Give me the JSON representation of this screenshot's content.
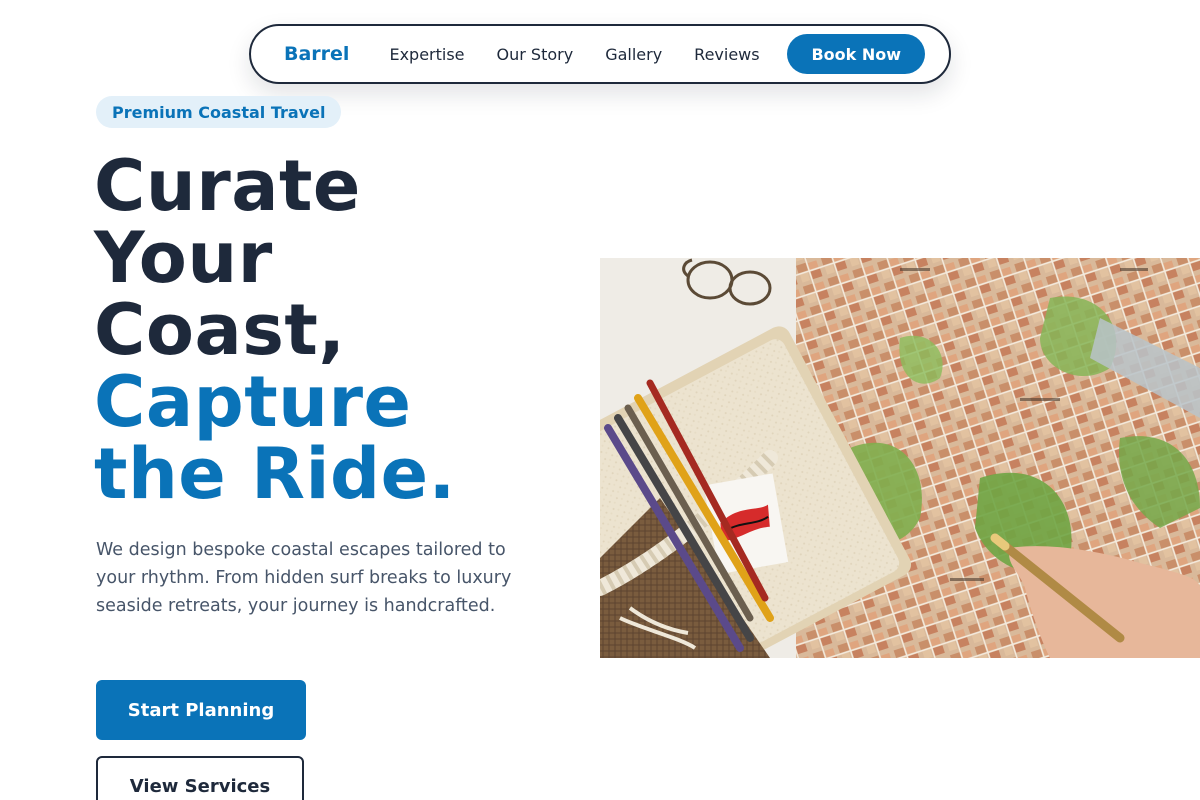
{
  "nav": {
    "brand": "Barrel",
    "links": [
      "Expertise",
      "Our Story",
      "Gallery",
      "Reviews"
    ],
    "cta": "Book Now"
  },
  "hero": {
    "badge": "Premium Coastal Travel",
    "headline_dark": [
      "Curate",
      "Your",
      "Coast,"
    ],
    "headline_accent": [
      "Capture",
      "the Ride."
    ],
    "description": "We design bespoke coastal escapes tailored to your rhythm. From hidden surf breaks to luxury seaside retreats, your journey is handcrafted.",
    "primary_cta": "Start Planning",
    "secondary_cta": "View Services"
  },
  "colors": {
    "accent": "#0a73b8",
    "text_dark": "#1e293b",
    "badge_bg": "#e3f0f9"
  }
}
